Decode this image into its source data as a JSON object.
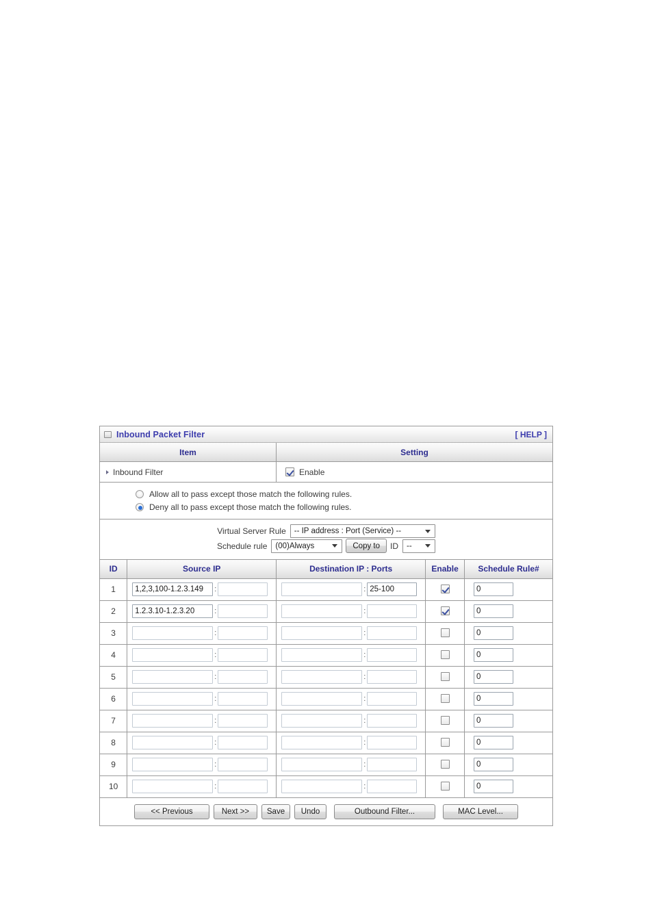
{
  "panel": {
    "title": "Inbound Packet Filter",
    "title_icon": "window-square-icon",
    "help_label": "[ HELP ]"
  },
  "table_head": {
    "item": "Item",
    "setting": "Setting"
  },
  "inbound_filter": {
    "label": "Inbound Filter",
    "enable_label": "Enable",
    "enabled": true
  },
  "policy": {
    "options": [
      {
        "label": "Allow all to pass except those match the following rules.",
        "selected": false
      },
      {
        "label": "Deny all to pass except those match the following rules.",
        "selected": true
      }
    ]
  },
  "selectors": {
    "virtual_server_rule_label": "Virtual Server Rule",
    "virtual_server_rule_value": "-- IP address : Port (Service) --",
    "schedule_rule_label": "Schedule rule",
    "schedule_rule_value": "(00)Always",
    "copy_to_label": "Copy to",
    "id_label": "ID",
    "id_value": "--"
  },
  "rules_table": {
    "columns": [
      "ID",
      "Source IP",
      "Destination IP : Ports",
      "Enable",
      "Schedule Rule#"
    ],
    "separator": ":",
    "rows": [
      {
        "id": "1",
        "source_ip": "1,2,3,100-1.2.3.149",
        "source_port": "",
        "dest_ip": "",
        "dest_ports": "25-100",
        "enable": true,
        "schedule_rule": "0"
      },
      {
        "id": "2",
        "source_ip": "1.2.3.10-1.2.3.20",
        "source_port": "",
        "dest_ip": "",
        "dest_ports": "",
        "enable": true,
        "schedule_rule": "0"
      },
      {
        "id": "3",
        "source_ip": "",
        "source_port": "",
        "dest_ip": "",
        "dest_ports": "",
        "enable": false,
        "schedule_rule": "0"
      },
      {
        "id": "4",
        "source_ip": "",
        "source_port": "",
        "dest_ip": "",
        "dest_ports": "",
        "enable": false,
        "schedule_rule": "0"
      },
      {
        "id": "5",
        "source_ip": "",
        "source_port": "",
        "dest_ip": "",
        "dest_ports": "",
        "enable": false,
        "schedule_rule": "0"
      },
      {
        "id": "6",
        "source_ip": "",
        "source_port": "",
        "dest_ip": "",
        "dest_ports": "",
        "enable": false,
        "schedule_rule": "0"
      },
      {
        "id": "7",
        "source_ip": "",
        "source_port": "",
        "dest_ip": "",
        "dest_ports": "",
        "enable": false,
        "schedule_rule": "0"
      },
      {
        "id": "8",
        "source_ip": "",
        "source_port": "",
        "dest_ip": "",
        "dest_ports": "",
        "enable": false,
        "schedule_rule": "0"
      },
      {
        "id": "9",
        "source_ip": "",
        "source_port": "",
        "dest_ip": "",
        "dest_ports": "",
        "enable": false,
        "schedule_rule": "0"
      },
      {
        "id": "10",
        "source_ip": "",
        "source_port": "",
        "dest_ip": "",
        "dest_ports": "",
        "enable": false,
        "schedule_rule": "0"
      }
    ]
  },
  "footer_buttons": [
    {
      "name": "previous",
      "label": "<< Previous",
      "width_class": "w-prev"
    },
    {
      "name": "next",
      "label": "Next >>",
      "width_class": "w-next"
    },
    {
      "name": "save",
      "label": "Save",
      "width_class": "w-save"
    },
    {
      "name": "undo",
      "label": "Undo",
      "width_class": "w-undo"
    },
    {
      "name": "outbound-filter",
      "label": "Outbound Filter...",
      "width_class": "w-out"
    },
    {
      "name": "mac-level",
      "label": "MAC Level...",
      "width_class": "w-mac"
    }
  ],
  "colors": {
    "heading_blue": "#2d2d8f",
    "title_blue": "#3c3cad",
    "border_gray": "#9a9a9a",
    "radio_accent": "#2a6fd6",
    "check_accent": "#3a4fa0"
  }
}
